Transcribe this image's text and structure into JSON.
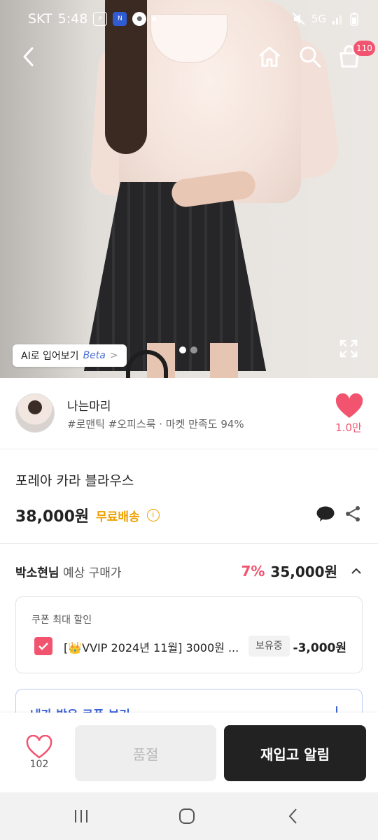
{
  "status_bar": {
    "carrier": "SKT",
    "time": "5:48",
    "network": "5G"
  },
  "nav": {
    "cart_count": "110"
  },
  "hero": {
    "ai_try_on_label": "AI로 입어보기",
    "ai_beta_label": "Beta",
    "page_count": 2,
    "current_page": 1
  },
  "store": {
    "name": "나는마리",
    "tags": "#로맨틱 #오피스룩 · 마켓 만족도 94%",
    "favorite_count": "1.0만"
  },
  "product": {
    "title": "포레아 카라 블라우스",
    "price": "38,000원",
    "shipping": "무료배송"
  },
  "expected_price": {
    "user": "박소현님",
    "label": "예상 구매가",
    "discount": "7%",
    "price": "35,000원"
  },
  "coupon": {
    "header": "쿠폰 최대 할인",
    "name": "[👑VVIP 2024년 11월] 3000원 ...",
    "status": "보유중",
    "amount": "-3,000원"
  },
  "my_coupon": {
    "label": "내가 받은 쿠폰 보기"
  },
  "bottom_bar": {
    "like_count": "102",
    "sold_out_label": "품절",
    "restock_label": "재입고 알림"
  },
  "colors": {
    "accent_pink": "#f2546f",
    "shipping_orange": "#f0a000",
    "coupon_blue": "#3c62d8"
  }
}
